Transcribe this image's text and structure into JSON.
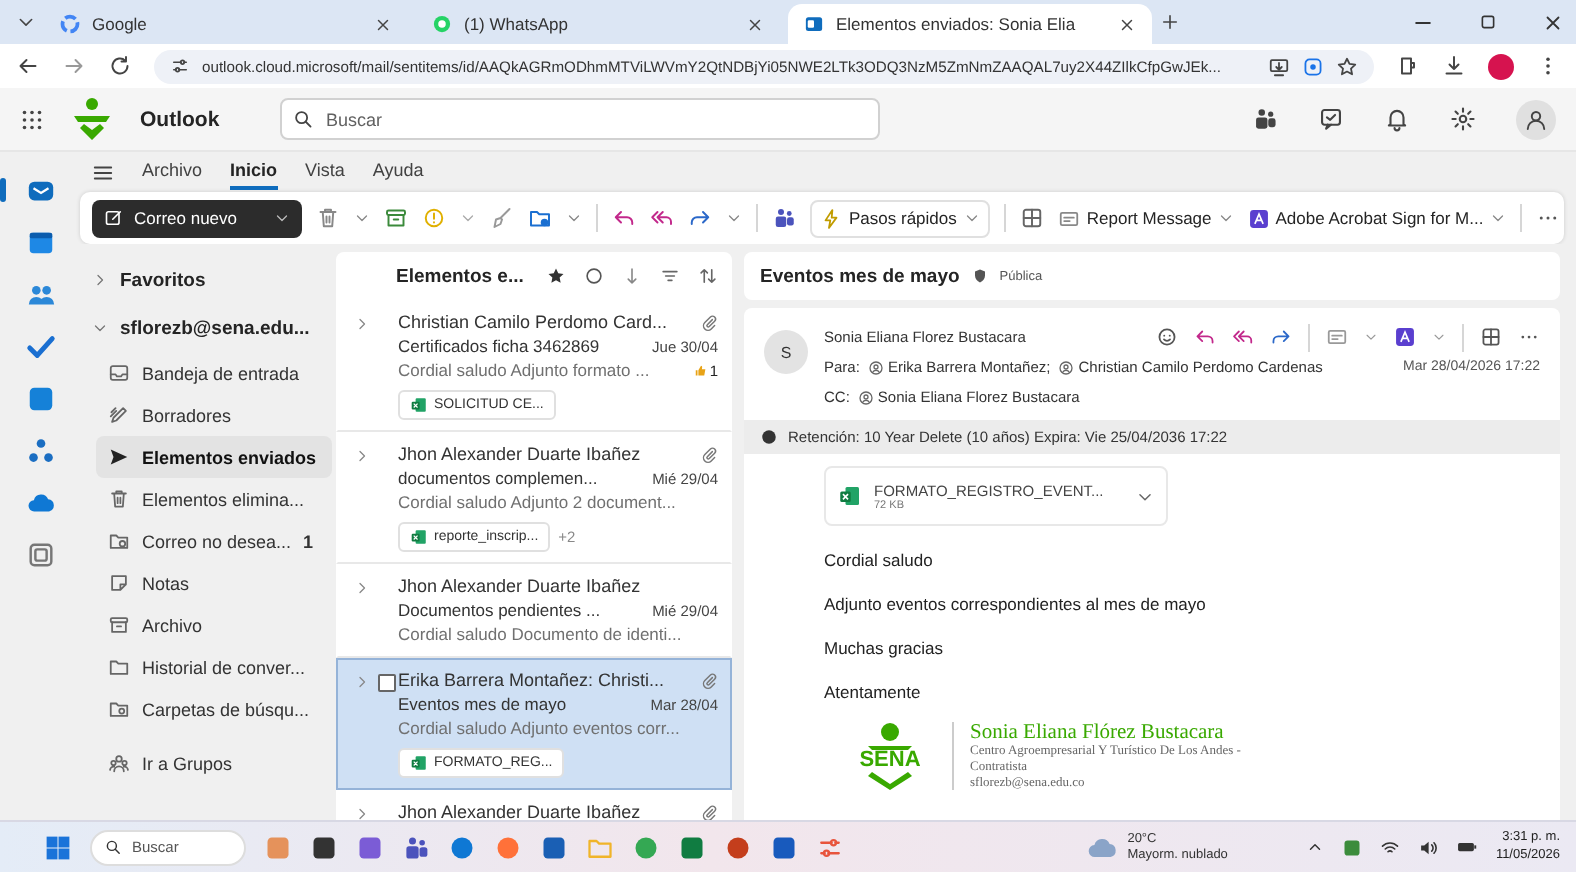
{
  "browser": {
    "tabs": [
      {
        "label": "Google",
        "selected": false
      },
      {
        "label": "(1) WhatsApp",
        "selected": false
      },
      {
        "label": "Elementos enviados: Sonia Elia",
        "selected": true
      }
    ],
    "url": "outlook.cloud.microsoft/mail/sentitems/id/AAQkAGRmODhmMTViLWVmY2QtNDBjYi05NWE2LTk3ODQ3NzM5ZmNmZAAQAL7uy2X44ZIlkCfpGwJEk..."
  },
  "header": {
    "app_name": "Outlook",
    "search_placeholder": "Buscar"
  },
  "ribbon": {
    "tabs": [
      {
        "label": "Archivo",
        "selected": false
      },
      {
        "label": "Inicio",
        "selected": true
      },
      {
        "label": "Vista",
        "selected": false
      },
      {
        "label": "Ayuda",
        "selected": false
      }
    ],
    "new_mail": "Correo nuevo",
    "quick_steps": "Pasos rápidos",
    "report": "Report Message",
    "acrobat": "Adobe Acrobat Sign for M..."
  },
  "folders": {
    "favorites": {
      "label": "Favoritos",
      "expanded": false
    },
    "account": {
      "label": "sflorezb@sena.edu...",
      "expanded": true
    },
    "items": [
      {
        "label": "Bandeja de entrada",
        "kind": "inbox",
        "selected": false
      },
      {
        "label": "Borradores",
        "kind": "drafts",
        "selected": false
      },
      {
        "label": "Elementos enviados",
        "kind": "sent",
        "selected": true
      },
      {
        "label": "Elementos elimina...",
        "kind": "trash",
        "selected": false
      },
      {
        "label": "Correo no desea...",
        "kind": "junk",
        "count": "1",
        "selected": false
      },
      {
        "label": "Notas",
        "kind": "notes",
        "selected": false
      },
      {
        "label": "Archivo",
        "kind": "archive",
        "selected": false
      },
      {
        "label": "Historial de conver...",
        "kind": "folder",
        "selected": false
      },
      {
        "label": "Carpetas de búsqu...",
        "kind": "search_folder",
        "selected": false
      }
    ],
    "groups": "Ir a Grupos"
  },
  "message_list": {
    "title": "Elementos e...",
    "messages": [
      {
        "sender": "Christian Camilo Perdomo Card...",
        "has_clip": true,
        "subject": "Certificados ficha 3462869",
        "date": "Jue 30/04",
        "preview": "Cordial saludo Adjunto formato ...",
        "reaction": "1",
        "attachment": "SOLICITUD CE...",
        "selected": false
      },
      {
        "sender": "Jhon Alexander Duarte Ibañez",
        "has_clip": true,
        "subject": "documentos complemen...",
        "date": "Mié 29/04",
        "preview": "Cordial saludo Adjunto 2 document...",
        "attachment": "reporte_inscrip...",
        "more": "+2",
        "selected": false
      },
      {
        "sender": "Jhon Alexander Duarte Ibañez",
        "has_clip": false,
        "subject": "Documentos pendientes ...",
        "date": "Mié 29/04",
        "preview": "Cordial saludo Documento de identi...",
        "selected": false
      },
      {
        "sender": "Erika Barrera Montañez: Christi...",
        "has_clip": true,
        "subject": "Eventos mes de mayo",
        "date": "Mar 28/04",
        "preview": "Cordial saludo Adjunto eventos corr...",
        "attachment": "FORMATO_REG...",
        "selected": true
      },
      {
        "sender": "Jhon Alexander Duarte Ibañez",
        "has_clip": true,
        "selected": false
      }
    ]
  },
  "reading": {
    "subject": "Eventos mes de mayo",
    "label": "Pública",
    "avatar": "S",
    "from": "Sonia Eliana Florez Bustacara",
    "to_label": "Para:",
    "to": [
      "Erika Barrera Montañez;",
      "Christian Camilo Perdomo Cardenas"
    ],
    "date": "Mar 28/04/2026 17:22",
    "cc_label": "CC:",
    "cc": [
      "Sonia Eliana Florez Bustacara"
    ],
    "retention": "Retención: 10 Year Delete (10 años) Expira: Vie 25/04/2036 17:22",
    "attachment": {
      "name": "FORMATO_REGISTRO_EVENT...",
      "size": "72 KB"
    },
    "body": [
      "Cordial saludo",
      "Adjunto eventos correspondientes al mes de mayo",
      "Muchas gracias",
      "Atentamente"
    ],
    "signature": {
      "logo_text": "SENA",
      "name": "Sonia Eliana Flórez Bustacara",
      "lines": [
        "Centro Agroempresarial Y Turístico De Los Andes -",
        "Contratista",
        "sflorezb@sena.edu.co"
      ]
    }
  },
  "taskbar": {
    "search_placeholder": "Buscar",
    "temperature": "20°C",
    "weather": "Mayorm. nublado",
    "time": "3:31 p. m.",
    "date": "11/05/2026"
  }
}
